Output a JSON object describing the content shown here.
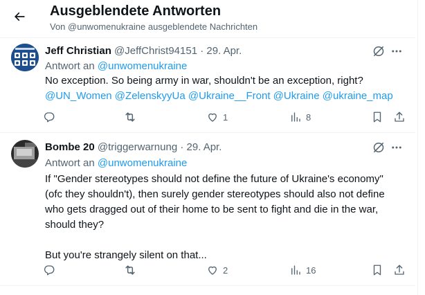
{
  "header": {
    "title": "Ausgeblendete Antworten",
    "subtitle": "Von @unwomenukraine ausgeblendete Nachrichten"
  },
  "tweets": [
    {
      "name": "Jeff Christian",
      "handle": "@JeffChrist94151",
      "dot": "·",
      "date": "29. Apr.",
      "reply_prefix": "Antwort an",
      "reply_handle": "@unwomenukraine",
      "lines": [
        "No exception. So being army in war, shouldn't be an exception, right?"
      ],
      "mentions": "@UN_Women @ZelenskyyUa @Ukraine__Front @Ukraine @ukraine_map",
      "likes": "1",
      "views": "8",
      "avatar_colors": [
        "#1d4e8f",
        "#ffffff"
      ]
    },
    {
      "name": "Bombe 20",
      "handle": "@triggerwarnung",
      "dot": "·",
      "date": "29. Apr.",
      "reply_prefix": "Antwort an",
      "reply_handle": "@unwomenukraine",
      "lines": [
        "If \"Gender stereotypes should not define the future of Ukraine's economy\"",
        "(ofc they shouldn't), then surely gender stereotypes should also not define",
        "who gets dragged out of their home to be sent to fight and die in the war,",
        "should they?",
        "",
        "But you're strangely silent on that..."
      ],
      "likes": "2",
      "views": "16",
      "avatar_colors": [
        "#3a3a3a",
        "#bdbdbd"
      ]
    }
  ],
  "icons": {
    "back": "arrow-left-icon",
    "hidden": "hidden-reply-icon",
    "more": "more-icon",
    "reply": "reply-icon",
    "retweet": "retweet-icon",
    "like": "like-icon",
    "views": "views-icon",
    "bookmark": "bookmark-icon",
    "share": "share-icon"
  },
  "colors": {
    "text": "#0f1419",
    "muted": "#536471",
    "link": "#1d9bf0",
    "divider": "#eff3f4"
  }
}
